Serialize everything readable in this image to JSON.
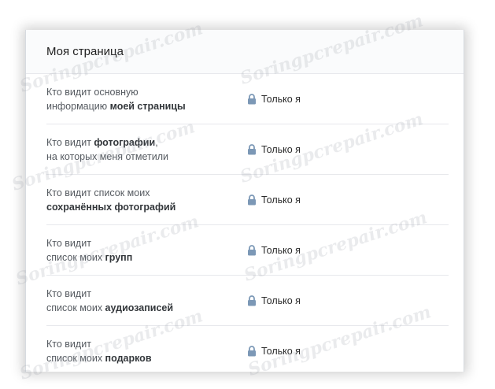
{
  "section": {
    "title": "Моя страница"
  },
  "rows": [
    {
      "line1": "Кто видит основную",
      "line2_prefix": "информацию ",
      "line2_bold": "моей страницы",
      "value": "Только я"
    },
    {
      "line1_prefix": "Кто видит ",
      "line1_bold": "фотографии",
      "line1_suffix": ",",
      "line2": "на которых меня отметили",
      "value": "Только я"
    },
    {
      "line1": "Кто видит список моих",
      "line2_bold": "сохранённых фотографий",
      "value": "Только я"
    },
    {
      "line1": "Кто видит",
      "line2_prefix": "список моих ",
      "line2_bold": "групп",
      "value": "Только я"
    },
    {
      "line1": "Кто видит",
      "line2_prefix": "список моих ",
      "line2_bold": "аудиозаписей",
      "value": "Только я"
    },
    {
      "line1": "Кто видит",
      "line2_prefix": "список моих ",
      "line2_bold": "подарков",
      "value": "Только я"
    }
  ],
  "watermark": {
    "text": "Soringpcrepair.com"
  },
  "icons": {
    "lock": "lock-icon",
    "lock_color": "#7c98b6"
  }
}
